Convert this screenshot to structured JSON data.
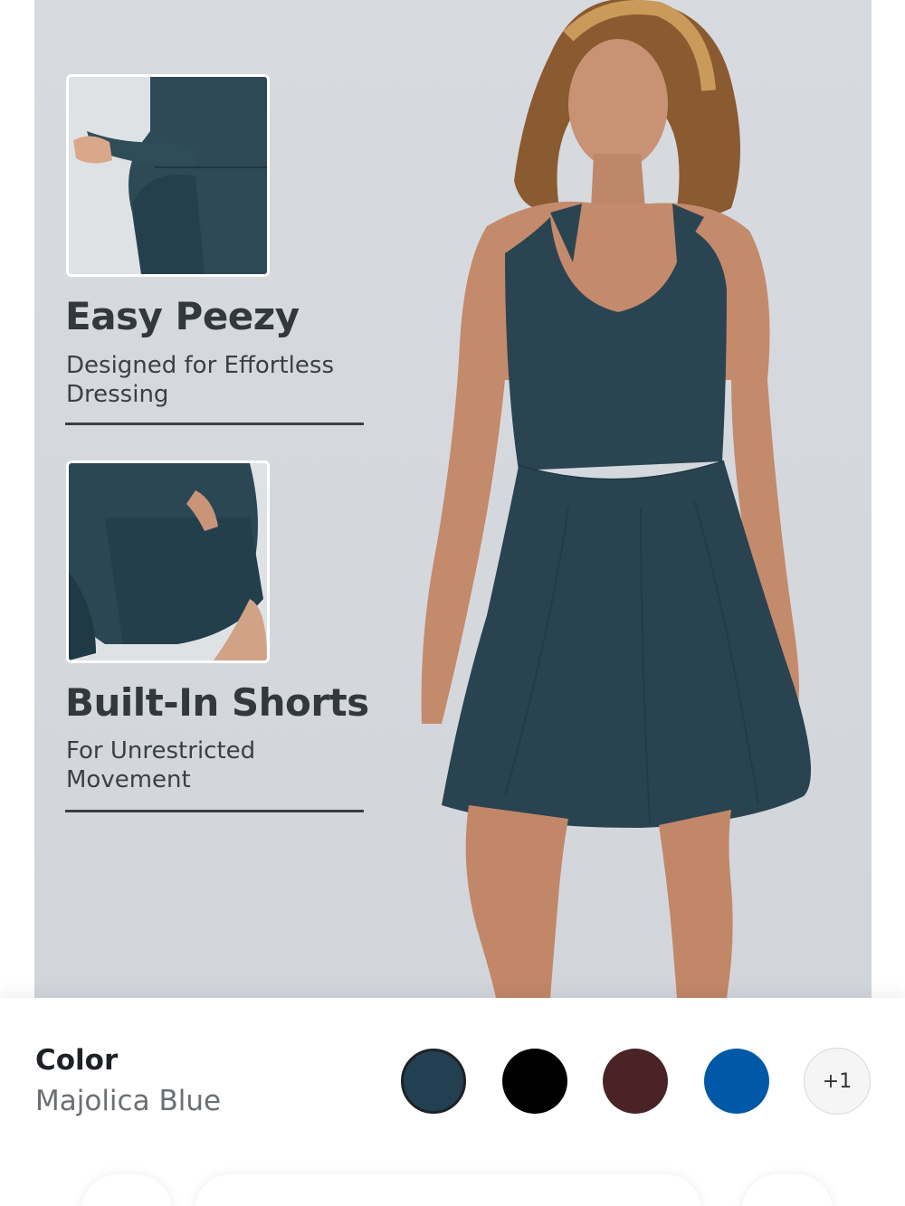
{
  "features": [
    {
      "title": "Easy Peezy",
      "subtitle": "Designed for Effortless Dressing"
    },
    {
      "title": "Built-In Shorts",
      "subtitle": "For Unrestricted Movement"
    }
  ],
  "color_picker": {
    "label": "Color",
    "selected_name": "Majolica Blue",
    "swatches": [
      {
        "name": "majolica-blue",
        "hex": "#233f52",
        "selected": true
      },
      {
        "name": "black",
        "hex": "#000000",
        "selected": false
      },
      {
        "name": "burgundy",
        "hex": "#4a2327",
        "selected": false
      },
      {
        "name": "royal-blue",
        "hex": "#0058a6",
        "selected": false
      }
    ],
    "more_label": "+1"
  },
  "colors": {
    "dress": "#2a4452",
    "hero_bg": "#d5d9de"
  }
}
